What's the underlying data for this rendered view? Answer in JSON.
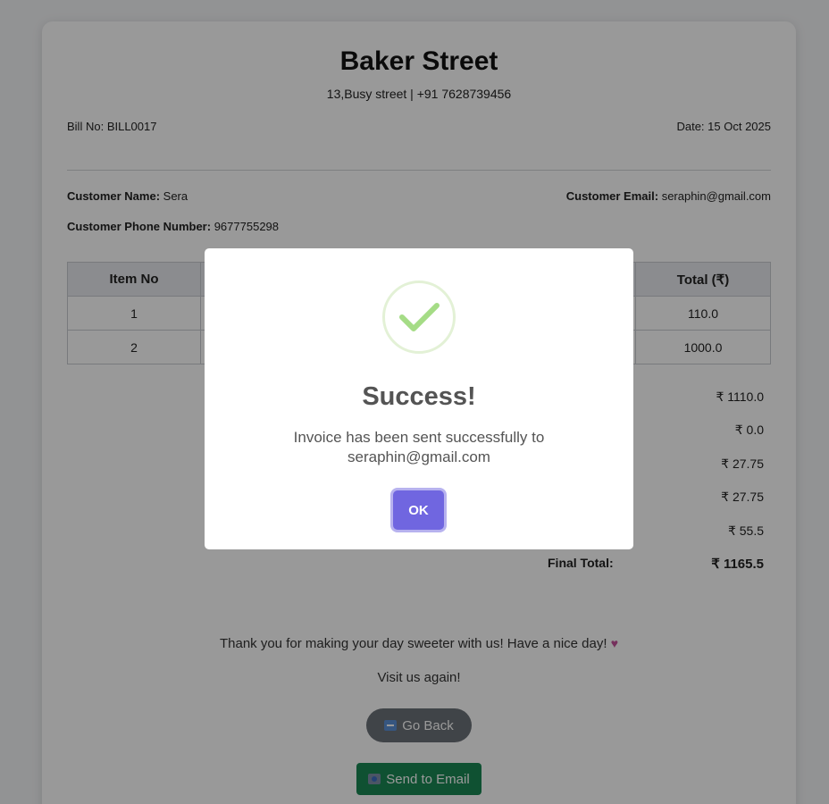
{
  "invoice": {
    "shop_name": "Baker Street",
    "shop_address_phone": "13,Busy street | +91 7628739456",
    "bill_no_label": "Bill No:",
    "bill_no": "BILL0017",
    "date_label": "Date:",
    "date": "15 Oct 2025",
    "customer_name_label": "Customer Name:",
    "customer_name": "Sera",
    "customer_email_label": "Customer Email:",
    "customer_email": "seraphin@gmail.com",
    "customer_phone_label": "Customer Phone Number:",
    "customer_phone": "9677755298"
  },
  "table": {
    "headers": [
      "Item No",
      "Total (₹)"
    ],
    "rows": [
      {
        "item_no": "1",
        "total": "110.0"
      },
      {
        "item_no": "2",
        "total": "1000.0"
      }
    ]
  },
  "summary": {
    "values": [
      "₹ 1110.0",
      "₹ 0.0",
      "₹ 27.75",
      "₹ 27.75",
      "₹ 55.5"
    ],
    "final_label": "Final Total:",
    "final_value": "₹ 1165.5"
  },
  "footer": {
    "thanks": "Thank you for making your day sweeter with us! Have a nice day!",
    "visit": "Visit us again!",
    "go_back_label": "Go Back",
    "send_email_label": "Send to Email"
  },
  "modal": {
    "title": "Success!",
    "message": "Invoice has been sent successfully to seraphin@gmail.com",
    "ok_label": "OK"
  },
  "colors": {
    "accent": "#7066e0",
    "success_green": "#a5dc86",
    "email_button": "#198754",
    "back_button": "#6c7278"
  }
}
